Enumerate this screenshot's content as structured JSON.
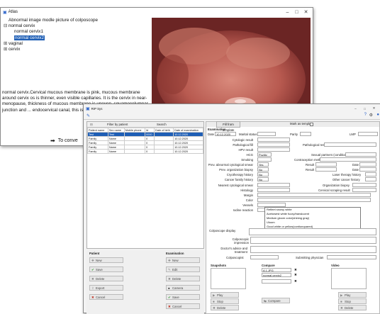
{
  "atlas_window": {
    "title": "Atlas",
    "tree": [
      {
        "label": "Abnormal image modle picture of colposcope",
        "level": 0,
        "exp": ""
      },
      {
        "label": "normal cervix",
        "level": 0,
        "exp": "⊟"
      },
      {
        "label": "normal cervix1",
        "level": 1,
        "exp": ""
      },
      {
        "label": "normal cervix2",
        "level": 1,
        "exp": "",
        "selected": true
      },
      {
        "label": "vaginal",
        "level": 0,
        "exp": "⊞"
      },
      {
        "label": "cervix",
        "level": 0,
        "exp": "⊞"
      }
    ],
    "description": "normal cervix.Cervical mucous membrane is pink, mucous membrane around cervix os is thinner, even visible capillaries. It is the cervix in near-menopause, thickness of mucous membrane is uneven, squamocolumnar junction and ... endocervical canal, this is for low-estrogen level",
    "convert_label": "To conve"
  },
  "rip_window": {
    "title": "RIP Sys",
    "filter_label": "Filter by patient",
    "search_label": "Search",
    "patients_table": {
      "headers": [
        "Patient name",
        "Sex name",
        "Mobile phone",
        "Id",
        "Date of birth",
        "Date of examination"
      ],
      "rows": [
        [
          "Test",
          "Test",
          "",
          "0000",
          "",
          "10.12.2020"
        ],
        [
          "Family",
          "Name",
          "",
          "0",
          "",
          "10.12.2020"
        ],
        [
          "Family",
          "Name",
          "",
          "0",
          "",
          "10.12.2020"
        ],
        [
          "Family",
          "Name",
          "",
          "0",
          "",
          "10.12.2020"
        ],
        [
          "Family",
          "Name",
          "",
          "0",
          "",
          "10.12.2020"
        ]
      ]
    },
    "patient_section": {
      "title": "Patient",
      "buttons": [
        "New",
        "Save",
        "Delete",
        "Export",
        "Cancel"
      ]
    },
    "exam_section": {
      "title": "Examination",
      "buttons": [
        "New",
        "Edit",
        "Delete",
        "Camera",
        "Save",
        "Cancel"
      ]
    },
    "form": {
      "fill_template": "Fill from template",
      "mark_template": "Mark as template",
      "examination_label": "Examination",
      "date_label": "Date",
      "date_value": "10.12.2020",
      "marital_label": "Marital status",
      "parity_label": "Parity",
      "lmp_label": "LMP",
      "fields": [
        {
          "label": "Cytologic result",
          "value": ""
        },
        {
          "label": "Pathological fill",
          "value": ""
        },
        {
          "label": "HPV result",
          "value": ""
        },
        {
          "label": "HCG",
          "value": "Pozitiv"
        },
        {
          "label": "Smoking",
          "value": ""
        },
        {
          "label": "Prev. abnormal cytological smear",
          "value": "Yes"
        },
        {
          "label": "Prev. organization biopsy",
          "value": "No"
        },
        {
          "label": "Cryotherapy history",
          "value": "No"
        },
        {
          "label": "Cancer family history",
          "value": "No"
        },
        {
          "label": "Nearest cytological smear",
          "value": ""
        },
        {
          "label": "Histology",
          "value": ""
        },
        {
          "label": "Margin",
          "value": ""
        },
        {
          "label": "Color",
          "value": ""
        },
        {
          "label": "Vessels",
          "value": ""
        },
        {
          "label": "Iodine reaction",
          "value": ""
        }
      ],
      "pathological_result_label": "Pathological result",
      "sexual_partners_label": "Sexual partners (conditions)",
      "contraception_label": "Contraception method",
      "result_label": "Result",
      "date_small_label": "Date",
      "laser_label": "Laser therapy history",
      "other_cancer_label": "Other cancer history",
      "organization_biopsy_label": "Organization biopsy",
      "cervical_scraping_label": "Cervical scraping result",
      "color_options": [
        "Refleet snowy white",
        "Acetowest white fuzzy/translucent",
        "Medium gloom color(shining gray)",
        "Uloom",
        "Good white or yellow(contiunquared)"
      ],
      "colposcope_display_label": "Colposcope display",
      "impression_label": "Colposcopic impression",
      "doctor_advice_label": "Doctor's advice and treatment",
      "colposcopist_label": "Colposcopist",
      "submitting_physician_label": "Submitting physician"
    },
    "snapshots_label": "Snapshots",
    "compare_label": "Compare",
    "compare_items": [
      "A 1.JPG",
      "normal cervix2"
    ],
    "video_label": "Video",
    "snapshot_buttons": [
      "Play",
      "Stop",
      "Delete"
    ],
    "compare_button": "Compare",
    "video_buttons": [
      "Play",
      "Stop",
      "Delete"
    ]
  }
}
